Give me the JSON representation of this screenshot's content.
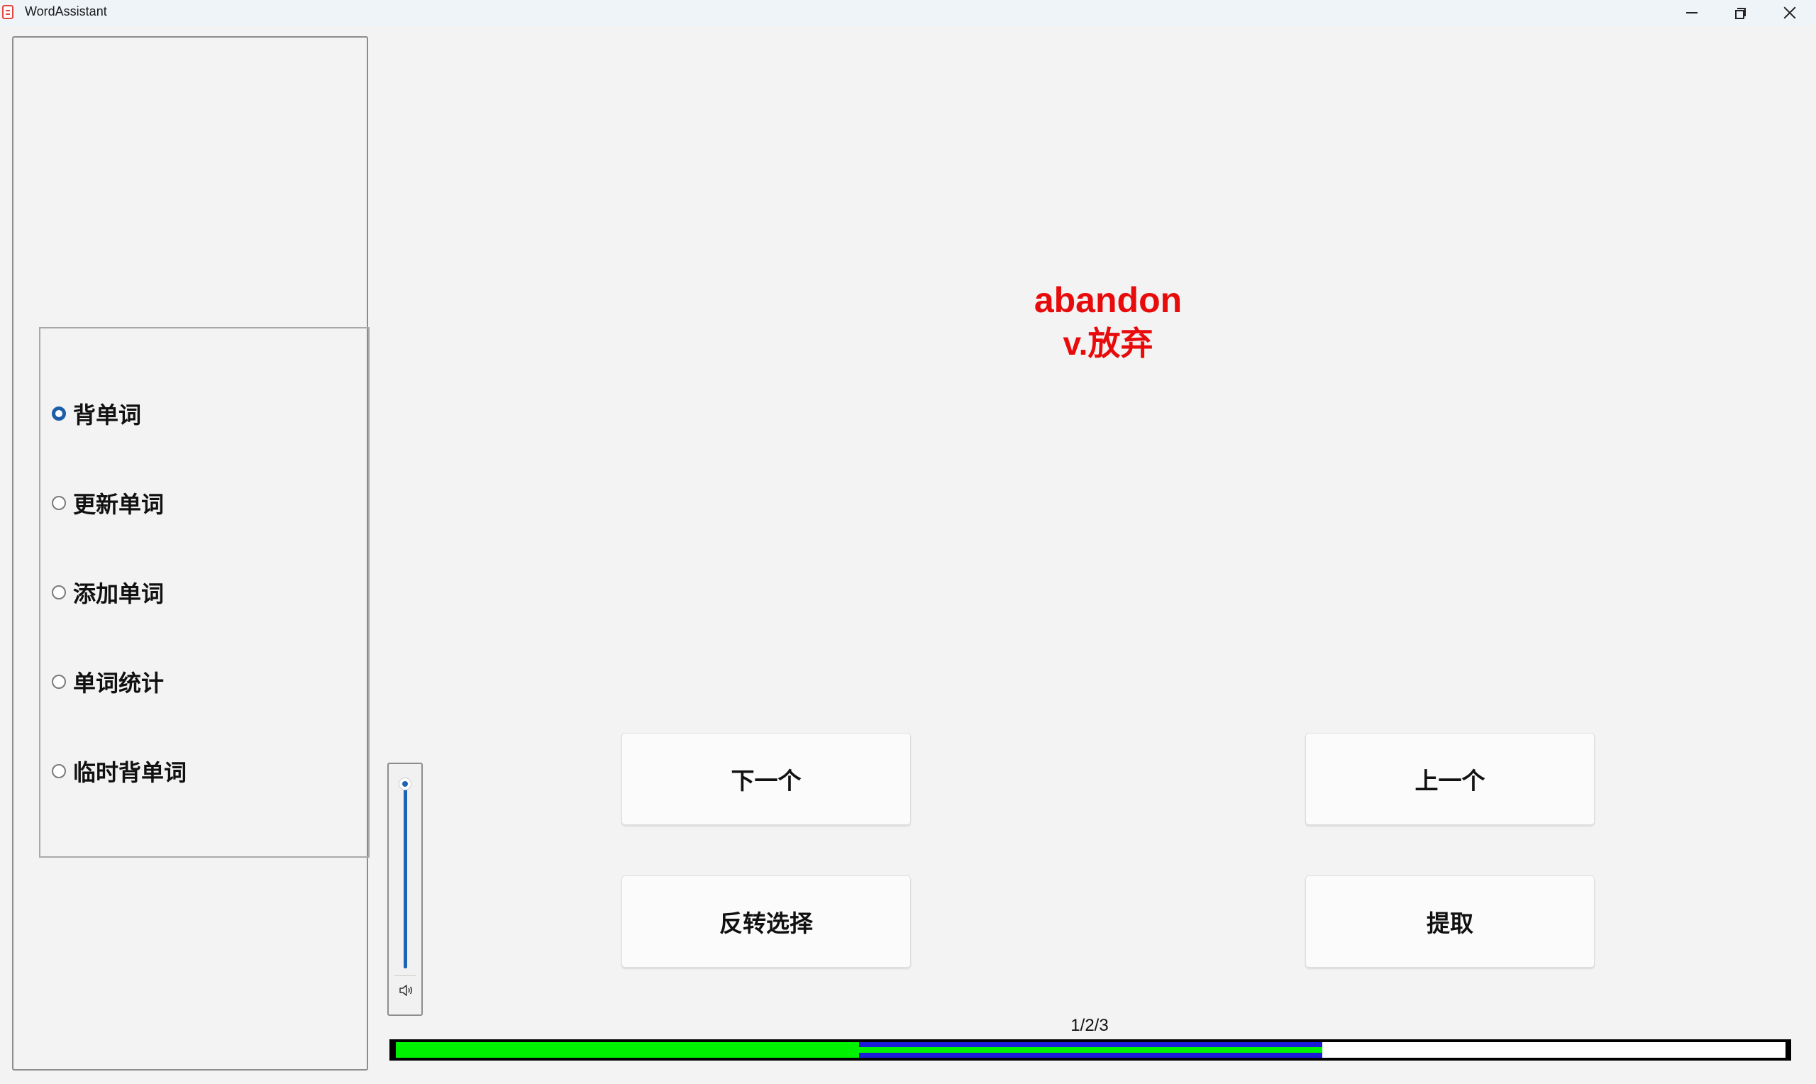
{
  "window": {
    "title": "WordAssistant"
  },
  "sidebar": {
    "options": [
      {
        "label": "背单词",
        "checked": true
      },
      {
        "label": "更新单词",
        "checked": false
      },
      {
        "label": "添加单词",
        "checked": false
      },
      {
        "label": "单词统计",
        "checked": false
      },
      {
        "label": "临时背单词",
        "checked": false
      }
    ]
  },
  "word_card": {
    "word": "abandon",
    "meaning": "v.放弃",
    "color": "#e80b0b"
  },
  "buttons": {
    "next": "下一个",
    "previous": "上一个",
    "invert_selection": "反转选择",
    "extract": "提取"
  },
  "volume": {
    "level": 1.0,
    "icon": "speaker-icon"
  },
  "progress": {
    "counter_text": "1/2/3",
    "current": 1,
    "reviewed": 2,
    "total": 3,
    "colors": {
      "current": "#00f200",
      "reviewed": "#1b1bd8",
      "remaining": "#ffffff"
    }
  }
}
